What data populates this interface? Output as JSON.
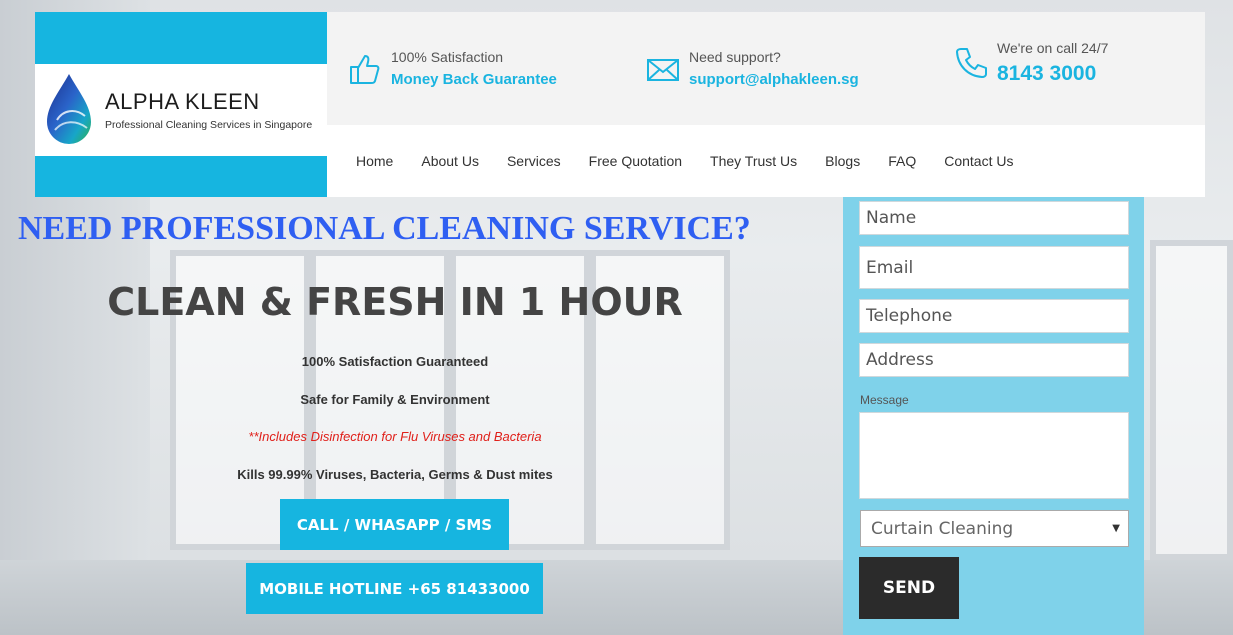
{
  "brand": {
    "name": "ALPHA  KLEEN",
    "tagline": "Professional Cleaning Services in Singapore"
  },
  "topbar": {
    "satisfaction": {
      "small": "100% Satisfaction",
      "big": "Money Back Guarantee",
      "icon": "thumbs-up-icon"
    },
    "support": {
      "small": "Need support?",
      "big": "support@alphakleen.sg",
      "icon": "envelope-icon"
    },
    "call": {
      "small": "We're on call 24/7",
      "big": "8143 3000",
      "icon": "phone-icon"
    }
  },
  "nav": {
    "items": [
      "Home",
      "About Us",
      "Services",
      "Free Quotation",
      "They Trust Us",
      "Blogs",
      "FAQ",
      "Contact Us"
    ]
  },
  "hero": {
    "headline": "NEED PROFESSIONAL CLEANING SERVICE?",
    "subhead": "CLEAN & FRESH IN 1 HOUR",
    "lines": [
      "100% Satisfaction Guaranteed",
      "Safe for Family & Environment",
      "**Includes Disinfection for Flu Viruses and Bacteria",
      "Kills 99.99% Viruses, Bacteria, Germs & Dust mites"
    ],
    "call_button": "CALL / WHASAPP / SMS",
    "hotline_button": "MOBILE HOTLINE +65 81433000"
  },
  "form": {
    "name_placeholder": "Name",
    "email_placeholder": "Email",
    "telephone_placeholder": "Telephone",
    "address_placeholder": "Address",
    "message_label": "Message",
    "service_selected": "Curtain Cleaning",
    "send_label": "SEND"
  },
  "colors": {
    "accent": "#16b5e0",
    "headline": "#2f5ff2",
    "alert": "#e0201a"
  }
}
